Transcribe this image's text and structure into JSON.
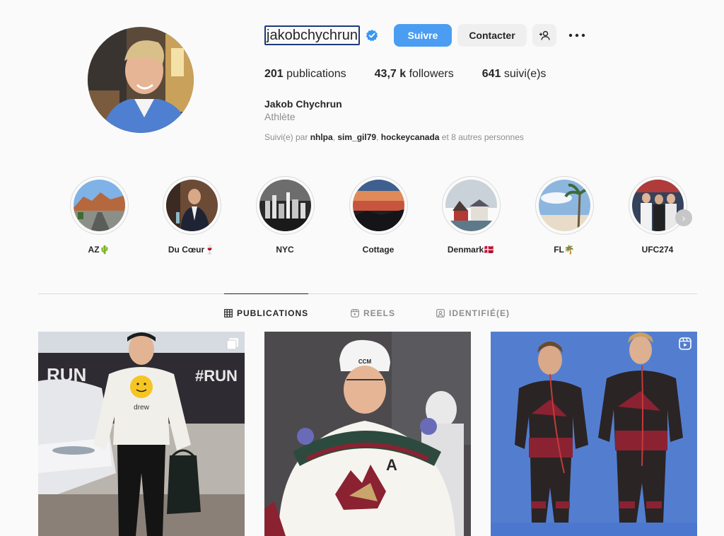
{
  "profile": {
    "username": "jakobchychrun",
    "full_name": "Jakob Chychrun",
    "category": "Athlète",
    "verified_icon": "verified-badge-icon",
    "followed_by_prefix": "Suivi(e) par ",
    "followed_by_users": [
      "nhlpa",
      "sim_gil79",
      "hockeycanada"
    ],
    "followed_by_sep": ", ",
    "followed_by_suffix": " et 8 autres personnes"
  },
  "actions": {
    "follow_label": "Suivre",
    "contact_label": "Contacter",
    "add_user_icon": "person-plus-icon",
    "more_icon": "more-horizontal-icon"
  },
  "stats": {
    "posts_count": "201",
    "posts_label": " publications",
    "followers_count": "43,7 k",
    "followers_label": " followers",
    "following_count": "641",
    "following_label": " suivi(e)s"
  },
  "highlights": [
    {
      "label": "AZ🌵"
    },
    {
      "label": "Du Cœur🍷"
    },
    {
      "label": "NYC"
    },
    {
      "label": "Cottage"
    },
    {
      "label": "Denmark🇩🇰"
    },
    {
      "label": "FL🌴"
    },
    {
      "label": "UFC274"
    }
  ],
  "tabs": [
    {
      "label": "PUBLICATIONS",
      "icon": "grid-icon",
      "active": true
    },
    {
      "label": "REELS",
      "icon": "reels-icon",
      "active": false
    },
    {
      "label": "IDENTIFIÉ(E)",
      "icon": "tagged-icon",
      "active": false
    }
  ],
  "posts": [
    {
      "badge": "carousel-icon",
      "shirt_text": "drew"
    },
    {
      "badge": "",
      "letter": "A"
    },
    {
      "badge": "reels-icon"
    }
  ],
  "colors": {
    "follow_button": "#4a9df1",
    "verified": "#3897f0",
    "text_primary": "#262626",
    "text_secondary": "#8e8e8e"
  }
}
